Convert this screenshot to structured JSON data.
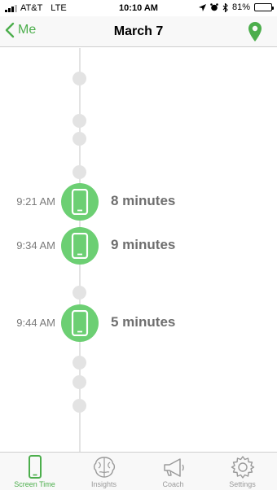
{
  "status_bar": {
    "carrier": "AT&T",
    "network": "LTE",
    "time": "10:10 AM",
    "battery": "81%",
    "battery_level": 0.81
  },
  "nav": {
    "back_label": "Me",
    "title": "March 7"
  },
  "timeline": {
    "sessions": [
      {
        "time": "9:21 AM",
        "duration": "8 minutes"
      },
      {
        "time": "9:34 AM",
        "duration": "9 minutes"
      },
      {
        "time": "9:44 AM",
        "duration": "5 minutes"
      }
    ]
  },
  "tabs": [
    {
      "label": "Screen Time",
      "icon": "phone-icon",
      "active": true
    },
    {
      "label": "Insights",
      "icon": "brain-icon",
      "active": false
    },
    {
      "label": "Coach",
      "icon": "megaphone-icon",
      "active": false
    },
    {
      "label": "Settings",
      "icon": "gear-icon",
      "active": false
    }
  ],
  "colors": {
    "accent": "#4cae4c",
    "session": "#6ccf73",
    "dot": "#e3e3e3"
  }
}
